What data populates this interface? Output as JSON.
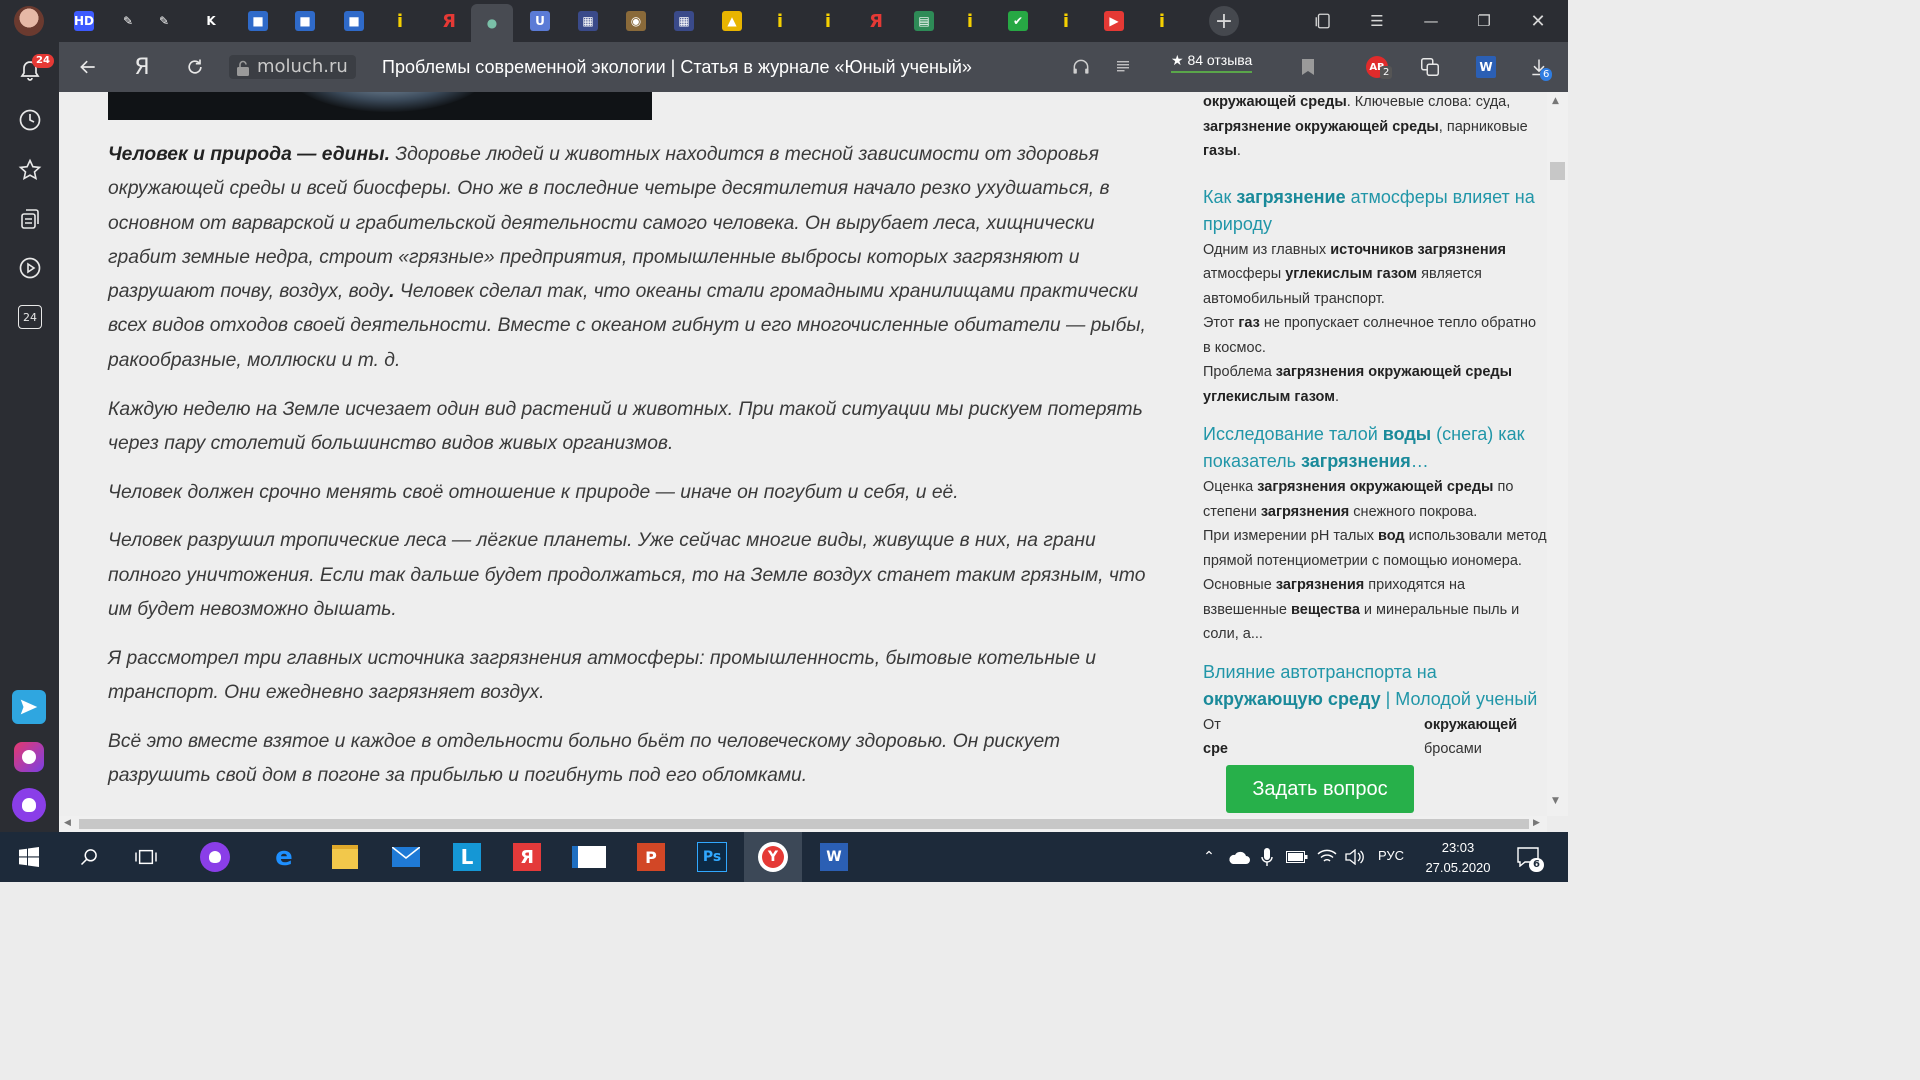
{
  "sidebar": {
    "notifications_badge": "24",
    "calendar_label": "24"
  },
  "tabs": [
    {
      "icon": "hd-icon",
      "glyph": "HD",
      "bg": "#3d5afe"
    },
    {
      "icon": "feather-icon",
      "glyph": "✎",
      "bg": "transparent"
    },
    {
      "icon": "feather-icon",
      "glyph": "✎",
      "bg": "transparent"
    },
    {
      "icon": "k-icon",
      "glyph": "K",
      "bg": "transparent"
    },
    {
      "icon": "chat-icon",
      "glyph": "■",
      "bg": "#2f6ac9"
    },
    {
      "icon": "chat-icon",
      "glyph": "■",
      "bg": "#2f6ac9"
    },
    {
      "icon": "chat-icon",
      "glyph": "■",
      "bg": "#2f6ac9"
    },
    {
      "icon": "info-icon",
      "glyph": "i",
      "bg": "transparent"
    },
    {
      "icon": "yandex-icon",
      "glyph": "Я",
      "bg": "transparent"
    },
    {
      "icon": "person-icon",
      "glyph": "●",
      "bg": "transparent"
    },
    {
      "icon": "shield-icon",
      "glyph": "U",
      "bg": "#5b7bd6"
    },
    {
      "icon": "qr-icon",
      "glyph": "▦",
      "bg": "#3a4a8a"
    },
    {
      "icon": "photo-icon",
      "glyph": "◉",
      "bg": "#8a6a3a"
    },
    {
      "icon": "qr-icon",
      "glyph": "▦",
      "bg": "#3a4a8a"
    },
    {
      "icon": "image-icon",
      "glyph": "▲",
      "bg": "#e8b400"
    },
    {
      "icon": "info-icon",
      "glyph": "i",
      "bg": "transparent"
    },
    {
      "icon": "info-icon",
      "glyph": "i",
      "bg": "transparent"
    },
    {
      "icon": "yandex-icon",
      "glyph": "Я",
      "bg": "transparent"
    },
    {
      "icon": "book-icon",
      "glyph": "▤",
      "bg": "#2e8b57"
    },
    {
      "icon": "info-icon",
      "glyph": "i",
      "bg": "transparent"
    },
    {
      "icon": "check-icon",
      "glyph": "✔",
      "bg": "#27a844"
    },
    {
      "icon": "info-icon",
      "glyph": "i",
      "bg": "transparent"
    },
    {
      "icon": "play-icon",
      "glyph": "▶",
      "bg": "#e53935"
    },
    {
      "icon": "info-icon",
      "glyph": "i",
      "bg": "transparent"
    }
  ],
  "addressbar": {
    "yandex_glyph": "Я",
    "domain": "moluch.ru",
    "title": "Проблемы современной экологии | Статья в журнале «Юный ученый»",
    "reviews": "★ 84 отзыва",
    "adblock_badge": "2",
    "downloads_badge": "6"
  },
  "article": {
    "p1_bold": "Человек и природа — едины.",
    "p1_text": " Здоровье людей и животных находится в тесной зависимости от здоровья окружающей среды и всей биосферы. Оно же в последние четыре десятилетия начало резко ухудшаться, в основном от варварской и грабительской деятельности самого человека. Он вырубает леса, хищнически грабит земные недра, строит «грязные» предприятия, промышленные выбросы которых загрязняют и разрушают почву, воздух, воду",
    "p1_dot": ".",
    "p1_text2": " Человек сделал так, что океаны стали громадными хранилищами практически всех видов отходов своей деятельности. Вместе с океаном гибнут и его многочисленные обитатели — рыбы, ракообразные, моллюски и т. д.",
    "p2": "Каждую неделю на Земле исчезает один вид растений и животных. При такой ситуации мы рискуем потерять через пару столетий большинство видов живых организмов.",
    "p3": "Человек должен срочно менять своё отношение к природе — иначе он погубит и себя, и её.",
    "p4": "Человек разрушил тропические леса — лёгкие планеты. Уже сейчас многие виды, живущие в них, на грани полного уничтожения. Если так дальше будет продолжаться, то на Земле воздух станет таким грязным, что им будет невозможно дышать.",
    "p5": "Я рассмотрел три главных источника загрязнения атмосферы: промышленность, бытовые котельные и транспорт. Они ежедневно загрязняет воздух.",
    "p6": "Всё это вместе взятое и каждое в отдельности больно бьёт по человеческому здоровью. Он рискует разрушить свой дом в погоне за прибылью и погибнуть под его обломками."
  },
  "related": {
    "r0": {
      "s1b": "окружающей среды",
      "s2": ". Ключевые слова: суда, ",
      "s3b": "загрязнение окружающей среды",
      "s4": ", парниковые ",
      "s5b": "газы",
      "s6": "."
    },
    "r1": {
      "t1": "Как ",
      "t2b": "загрязнение",
      "t3": " атмосферы влияет на природу",
      "a1": "Одним из главных ",
      "a2b": "источников загрязнения",
      "a3": " атмосферы ",
      "a4b": "углекислым газом",
      "a5": " является автомобильный транспорт.",
      "b1": "Этот ",
      "b2b": "газ",
      "b3": " не пропускает солнечное тепло обратно в космос.",
      "c1": "Проблема ",
      "c2b": "загрязнения окружающей среды углекислым газом",
      "c3": "."
    },
    "r2": {
      "t1": "Исследование талой ",
      "t2b": "воды",
      "t3": " (снега) как показатель ",
      "t4b": "загрязнения",
      "t5": "…",
      "a1": "Оценка ",
      "a2b": "загрязнения окружающей среды",
      "a3": " по степени ",
      "a4b": "загрязнения",
      "a5": " снежного покрова.",
      "b1": "При измерении pH талых ",
      "b2b": "вод",
      "b3": " использовали метод прямой потенциометрии с помощью иономера. Основные ",
      "b4b": "загрязнения",
      "b5": " приходятся на взвешенные ",
      "b6b": "вещества",
      "b7": " и минеральные пыль и соли, а..."
    },
    "r3": {
      "t1": "Влияние автотранспорта на ",
      "t2b": "окружающую среду",
      "t3": " | Молодой ученый",
      "a1": "От",
      "a2b": "окружающей",
      "a3b": "сре",
      "a4": "бросами"
    }
  },
  "ask_button": "Задать вопрос",
  "taskbar": {
    "language": "РУС",
    "time": "23:03",
    "date": "27.05.2020",
    "notifications_count": "6"
  }
}
